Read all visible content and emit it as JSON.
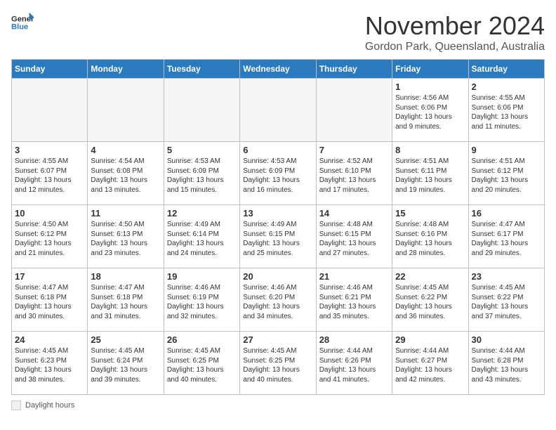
{
  "header": {
    "logo_general": "General",
    "logo_blue": "Blue",
    "month_title": "November 2024",
    "location": "Gordon Park, Queensland, Australia"
  },
  "days_of_week": [
    "Sunday",
    "Monday",
    "Tuesday",
    "Wednesday",
    "Thursday",
    "Friday",
    "Saturday"
  ],
  "legend_label": "Daylight hours",
  "weeks": [
    [
      {
        "num": "",
        "info": "",
        "empty": true
      },
      {
        "num": "",
        "info": "",
        "empty": true
      },
      {
        "num": "",
        "info": "",
        "empty": true
      },
      {
        "num": "",
        "info": "",
        "empty": true
      },
      {
        "num": "",
        "info": "",
        "empty": true
      },
      {
        "num": "1",
        "info": "Sunrise: 4:56 AM\nSunset: 6:06 PM\nDaylight: 13 hours\nand 9 minutes.",
        "empty": false
      },
      {
        "num": "2",
        "info": "Sunrise: 4:55 AM\nSunset: 6:06 PM\nDaylight: 13 hours\nand 11 minutes.",
        "empty": false
      }
    ],
    [
      {
        "num": "3",
        "info": "Sunrise: 4:55 AM\nSunset: 6:07 PM\nDaylight: 13 hours\nand 12 minutes.",
        "empty": false
      },
      {
        "num": "4",
        "info": "Sunrise: 4:54 AM\nSunset: 6:08 PM\nDaylight: 13 hours\nand 13 minutes.",
        "empty": false
      },
      {
        "num": "5",
        "info": "Sunrise: 4:53 AM\nSunset: 6:09 PM\nDaylight: 13 hours\nand 15 minutes.",
        "empty": false
      },
      {
        "num": "6",
        "info": "Sunrise: 4:53 AM\nSunset: 6:09 PM\nDaylight: 13 hours\nand 16 minutes.",
        "empty": false
      },
      {
        "num": "7",
        "info": "Sunrise: 4:52 AM\nSunset: 6:10 PM\nDaylight: 13 hours\nand 17 minutes.",
        "empty": false
      },
      {
        "num": "8",
        "info": "Sunrise: 4:51 AM\nSunset: 6:11 PM\nDaylight: 13 hours\nand 19 minutes.",
        "empty": false
      },
      {
        "num": "9",
        "info": "Sunrise: 4:51 AM\nSunset: 6:12 PM\nDaylight: 13 hours\nand 20 minutes.",
        "empty": false
      }
    ],
    [
      {
        "num": "10",
        "info": "Sunrise: 4:50 AM\nSunset: 6:12 PM\nDaylight: 13 hours\nand 21 minutes.",
        "empty": false
      },
      {
        "num": "11",
        "info": "Sunrise: 4:50 AM\nSunset: 6:13 PM\nDaylight: 13 hours\nand 23 minutes.",
        "empty": false
      },
      {
        "num": "12",
        "info": "Sunrise: 4:49 AM\nSunset: 6:14 PM\nDaylight: 13 hours\nand 24 minutes.",
        "empty": false
      },
      {
        "num": "13",
        "info": "Sunrise: 4:49 AM\nSunset: 6:15 PM\nDaylight: 13 hours\nand 25 minutes.",
        "empty": false
      },
      {
        "num": "14",
        "info": "Sunrise: 4:48 AM\nSunset: 6:15 PM\nDaylight: 13 hours\nand 27 minutes.",
        "empty": false
      },
      {
        "num": "15",
        "info": "Sunrise: 4:48 AM\nSunset: 6:16 PM\nDaylight: 13 hours\nand 28 minutes.",
        "empty": false
      },
      {
        "num": "16",
        "info": "Sunrise: 4:47 AM\nSunset: 6:17 PM\nDaylight: 13 hours\nand 29 minutes.",
        "empty": false
      }
    ],
    [
      {
        "num": "17",
        "info": "Sunrise: 4:47 AM\nSunset: 6:18 PM\nDaylight: 13 hours\nand 30 minutes.",
        "empty": false
      },
      {
        "num": "18",
        "info": "Sunrise: 4:47 AM\nSunset: 6:18 PM\nDaylight: 13 hours\nand 31 minutes.",
        "empty": false
      },
      {
        "num": "19",
        "info": "Sunrise: 4:46 AM\nSunset: 6:19 PM\nDaylight: 13 hours\nand 32 minutes.",
        "empty": false
      },
      {
        "num": "20",
        "info": "Sunrise: 4:46 AM\nSunset: 6:20 PM\nDaylight: 13 hours\nand 34 minutes.",
        "empty": false
      },
      {
        "num": "21",
        "info": "Sunrise: 4:46 AM\nSunset: 6:21 PM\nDaylight: 13 hours\nand 35 minutes.",
        "empty": false
      },
      {
        "num": "22",
        "info": "Sunrise: 4:45 AM\nSunset: 6:22 PM\nDaylight: 13 hours\nand 36 minutes.",
        "empty": false
      },
      {
        "num": "23",
        "info": "Sunrise: 4:45 AM\nSunset: 6:22 PM\nDaylight: 13 hours\nand 37 minutes.",
        "empty": false
      }
    ],
    [
      {
        "num": "24",
        "info": "Sunrise: 4:45 AM\nSunset: 6:23 PM\nDaylight: 13 hours\nand 38 minutes.",
        "empty": false
      },
      {
        "num": "25",
        "info": "Sunrise: 4:45 AM\nSunset: 6:24 PM\nDaylight: 13 hours\nand 39 minutes.",
        "empty": false
      },
      {
        "num": "26",
        "info": "Sunrise: 4:45 AM\nSunset: 6:25 PM\nDaylight: 13 hours\nand 40 minutes.",
        "empty": false
      },
      {
        "num": "27",
        "info": "Sunrise: 4:45 AM\nSunset: 6:25 PM\nDaylight: 13 hours\nand 40 minutes.",
        "empty": false
      },
      {
        "num": "28",
        "info": "Sunrise: 4:44 AM\nSunset: 6:26 PM\nDaylight: 13 hours\nand 41 minutes.",
        "empty": false
      },
      {
        "num": "29",
        "info": "Sunrise: 4:44 AM\nSunset: 6:27 PM\nDaylight: 13 hours\nand 42 minutes.",
        "empty": false
      },
      {
        "num": "30",
        "info": "Sunrise: 4:44 AM\nSunset: 6:28 PM\nDaylight: 13 hours\nand 43 minutes.",
        "empty": false
      }
    ]
  ]
}
